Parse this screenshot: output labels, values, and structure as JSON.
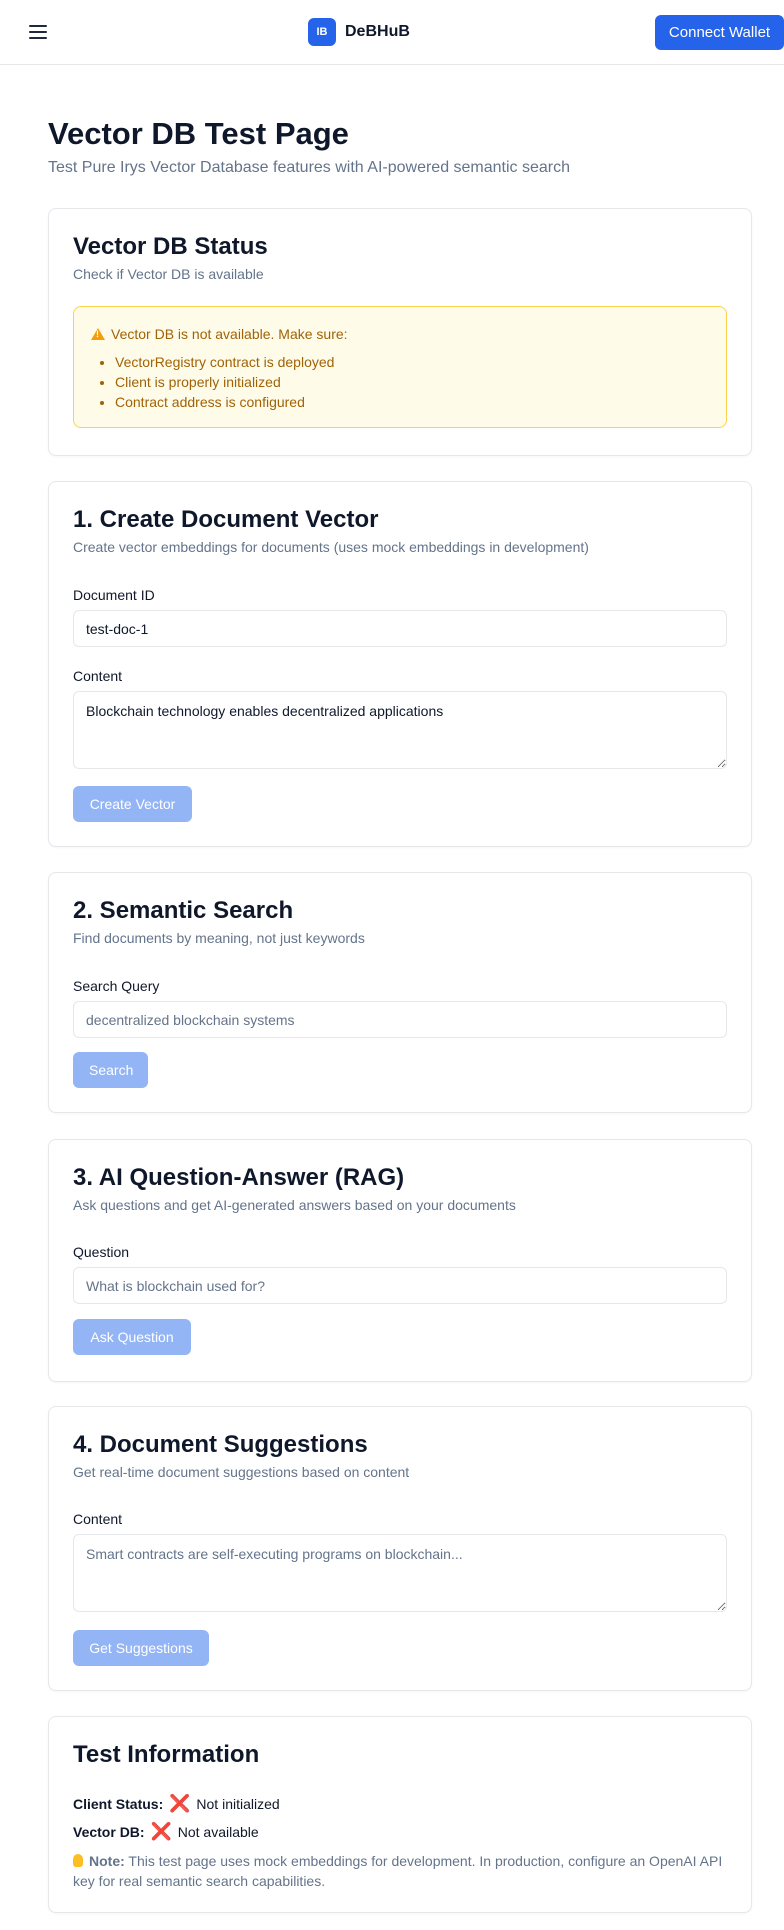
{
  "header": {
    "logo_text": "IB",
    "brand": "DeBHuB",
    "connect_label": "Connect Wallet"
  },
  "page": {
    "title": "Vector DB Test Page",
    "subtitle": "Test Pure Irys Vector Database features with AI-powered semantic search"
  },
  "status": {
    "title": "Vector DB Status",
    "desc": "Check if Vector DB is available",
    "alert_title": "Vector DB is not available. Make sure:",
    "alert_items": [
      "VectorRegistry contract is deployed",
      "Client is properly initialized",
      "Contract address is configured"
    ]
  },
  "create": {
    "title": "1. Create Document Vector",
    "desc": "Create vector embeddings for documents (uses mock embeddings in development)",
    "id_label": "Document ID",
    "id_value": "test-doc-1",
    "content_label": "Content",
    "content_value": "Blockchain technology enables decentralized applications",
    "button": "Create Vector"
  },
  "search": {
    "title": "2. Semantic Search",
    "desc": "Find documents by meaning, not just keywords",
    "label": "Search Query",
    "placeholder": "decentralized blockchain systems",
    "button": "Search"
  },
  "rag": {
    "title": "3. AI Question-Answer (RAG)",
    "desc": "Ask questions and get AI-generated answers based on your documents",
    "label": "Question",
    "placeholder": "What is blockchain used for?",
    "button": "Ask Question"
  },
  "suggest": {
    "title": "4. Document Suggestions",
    "desc": "Get real-time document suggestions based on content",
    "label": "Content",
    "placeholder": "Smart contracts are self-executing programs on blockchain...",
    "button": "Get Suggestions"
  },
  "info": {
    "title": "Test Information",
    "client_label": "Client Status:",
    "client_value": "Not initialized",
    "vdb_label": "Vector DB:",
    "vdb_value": "Not available",
    "note_label": "Note:",
    "note_text": "This test page uses mock embeddings for development. In production, configure an OpenAI API key for real semantic search capabilities.",
    "x_icon": "❌"
  },
  "colors": {
    "primary": "#2563eb",
    "disabled_button": "#93b4f5",
    "alert_bg": "#fefce8",
    "alert_text": "#a16207"
  }
}
